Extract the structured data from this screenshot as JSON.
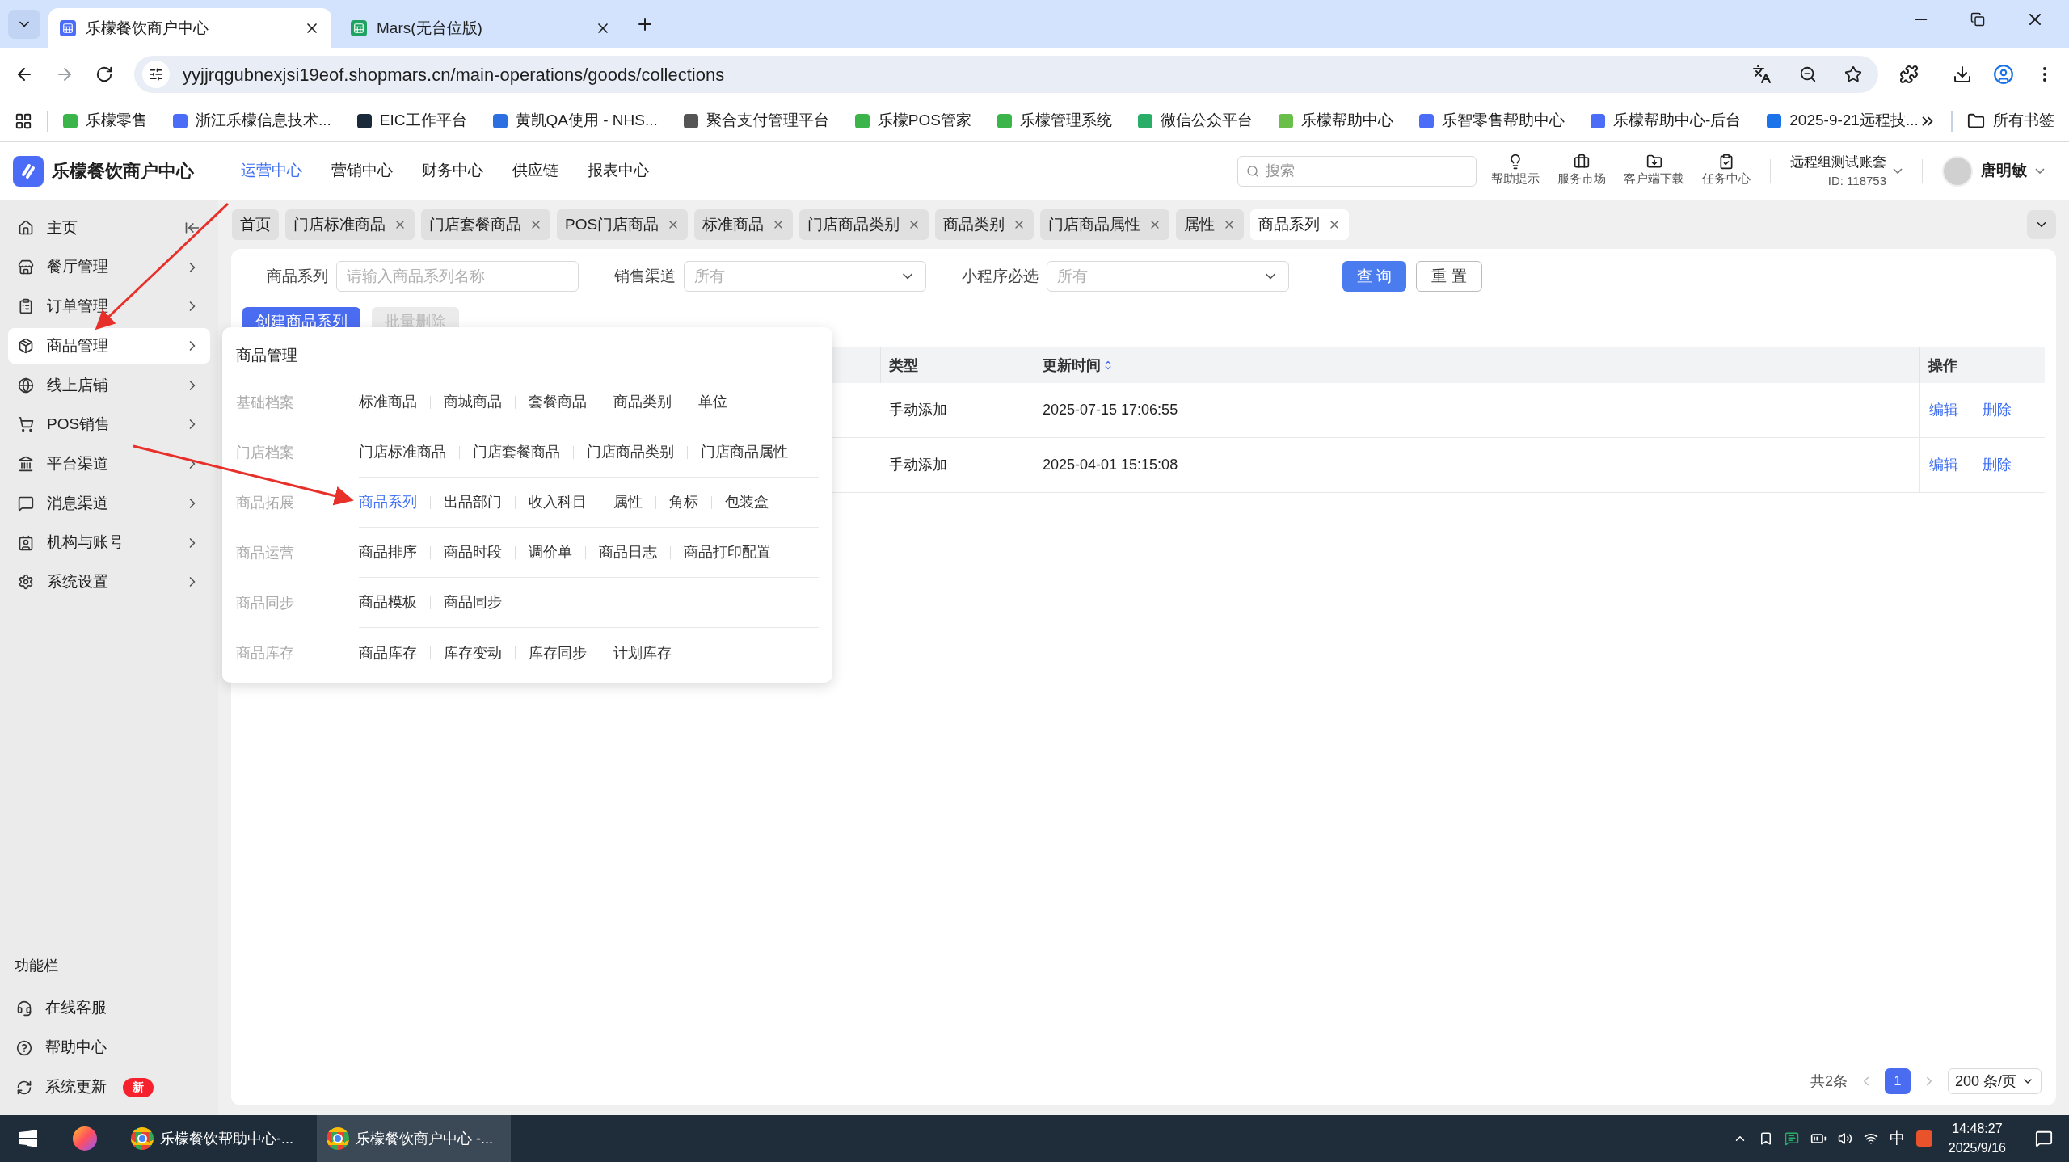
{
  "browser": {
    "tabs": [
      {
        "title": "乐檬餐饮商户中心",
        "selected": true,
        "color": "#4a6cf7"
      },
      {
        "title": "Mars(无台位版)",
        "selected": false,
        "color": "#1ea362"
      }
    ],
    "address": "yyjjrqgubnexjsi19eof.shopmars.cn/main-operations/goods/collections",
    "bookmarks": [
      {
        "label": "乐檬零售",
        "color": "#3bb54a"
      },
      {
        "label": "浙江乐檬信息技术...",
        "color": "#4a6cf7"
      },
      {
        "label": "EIC工作平台",
        "color": "#1a2a3a"
      },
      {
        "label": "黄凯QA使用 - NHS...",
        "color": "#2b6fe0"
      },
      {
        "label": "聚合支付管理平台",
        "color": "#555555"
      },
      {
        "label": "乐檬POS管家",
        "color": "#3bb54a"
      },
      {
        "label": "乐檬管理系统",
        "color": "#3bb54a"
      },
      {
        "label": "微信公众平台",
        "color": "#2aae67"
      },
      {
        "label": "乐檬帮助中心",
        "color": "#6abf4b"
      },
      {
        "label": "乐智零售帮助中心",
        "color": "#4a6cf7"
      },
      {
        "label": "乐檬帮助中心-后台",
        "color": "#4a6cf7"
      },
      {
        "label": "2025-9-21远程技...",
        "color": "#1a73e8"
      }
    ],
    "all_bookmarks": "所有书签"
  },
  "app": {
    "brand": "乐檬餐饮商户中心",
    "nav": [
      {
        "label": "运营中心",
        "selected": true
      },
      {
        "label": "营销中心",
        "selected": false
      },
      {
        "label": "财务中心",
        "selected": false
      },
      {
        "label": "供应链",
        "selected": false
      },
      {
        "label": "报表中心",
        "selected": false
      }
    ],
    "search": {
      "placeholder": "搜索"
    },
    "tools": [
      {
        "label": "帮助提示",
        "kind": "bulb"
      },
      {
        "label": "服务市场",
        "kind": "briefcase"
      },
      {
        "label": "客户端下载",
        "kind": "folder"
      },
      {
        "label": "任务中心",
        "kind": "clipboard"
      }
    ],
    "account": {
      "name": "远程组测试账套",
      "id": "ID: 118753"
    },
    "user": "唐明敏"
  },
  "sidebar": {
    "items": [
      {
        "label": "主页",
        "kind": "home",
        "selected": false
      },
      {
        "label": "餐厅管理",
        "kind": "store",
        "selected": false
      },
      {
        "label": "订单管理",
        "kind": "order",
        "selected": false
      },
      {
        "label": "商品管理",
        "kind": "goods",
        "selected": true
      },
      {
        "label": "线上店铺",
        "kind": "globe",
        "selected": false
      },
      {
        "label": "POS销售",
        "kind": "cart",
        "selected": false
      },
      {
        "label": "平台渠道",
        "kind": "bank",
        "selected": false
      },
      {
        "label": "消息渠道",
        "kind": "message",
        "selected": false
      },
      {
        "label": "机构与账号",
        "kind": "contact",
        "selected": false
      },
      {
        "label": "系统设置",
        "kind": "settings",
        "selected": false
      }
    ],
    "function_bar": {
      "title": "功能栏",
      "items": [
        {
          "label": "在线客服",
          "kind": "service"
        },
        {
          "label": "帮助中心",
          "kind": "help"
        },
        {
          "label": "系统更新",
          "kind": "update",
          "badge": "新"
        }
      ]
    }
  },
  "page_tabs": [
    {
      "label": "首页",
      "selected": false,
      "closable": false
    },
    {
      "label": "门店标准商品",
      "selected": false,
      "closable": true
    },
    {
      "label": "门店套餐商品",
      "selected": false,
      "closable": true
    },
    {
      "label": "POS门店商品",
      "selected": false,
      "closable": true
    },
    {
      "label": "标准商品",
      "selected": false,
      "closable": true
    },
    {
      "label": "门店商品类别",
      "selected": false,
      "closable": true
    },
    {
      "label": "商品类别",
      "selected": false,
      "closable": true
    },
    {
      "label": "门店商品属性",
      "selected": false,
      "closable": true
    },
    {
      "label": "属性",
      "selected": false,
      "closable": true
    },
    {
      "label": "商品系列",
      "selected": true,
      "closable": true
    }
  ],
  "filters": [
    {
      "label": "商品系列",
      "kind": "input",
      "placeholder": "请输入商品系列名称"
    },
    {
      "label": "销售渠道",
      "kind": "select",
      "placeholder": "所有"
    },
    {
      "label": "小程序必选",
      "kind": "select",
      "placeholder": "所有"
    }
  ],
  "filter_buttons": [
    {
      "label": "查 询",
      "kind": "primary"
    },
    {
      "label": "重 置",
      "kind": "default"
    }
  ],
  "actions": [
    {
      "label": "创建商品系列",
      "disabled": false
    },
    {
      "label": "批量删除",
      "disabled": true
    }
  ],
  "table": {
    "columns": [
      {
        "label": "类型",
        "sortable": false
      },
      {
        "label": "更新时间",
        "sortable": true
      },
      {
        "label": "操作",
        "sortable": false
      }
    ],
    "rows": [
      {
        "type": "手动添加",
        "updated": "2025-07-15 17:06:55",
        "actions": [
          "编辑",
          "删除"
        ]
      },
      {
        "type": "手动添加",
        "updated": "2025-04-01 15:15:08",
        "actions": [
          "编辑",
          "删除"
        ]
      }
    ]
  },
  "pagination": {
    "total": "共2条",
    "pages": [
      {
        "label": "1",
        "selected": true
      }
    ],
    "page_size": "200 条/页"
  },
  "menu": {
    "title": "商品管理",
    "groups": [
      {
        "label": "基础档案",
        "links": [
          {
            "label": "标准商品",
            "selected": false
          },
          {
            "label": "商城商品",
            "selected": false
          },
          {
            "label": "套餐商品",
            "selected": false
          },
          {
            "label": "商品类别",
            "selected": false
          },
          {
            "label": "单位",
            "selected": false
          }
        ]
      },
      {
        "label": "门店档案",
        "links": [
          {
            "label": "门店标准商品",
            "selected": false
          },
          {
            "label": "门店套餐商品",
            "selected": false
          },
          {
            "label": "门店商品类别",
            "selected": false
          },
          {
            "label": "门店商品属性",
            "selected": false
          }
        ]
      },
      {
        "label": "商品拓展",
        "links": [
          {
            "label": "商品系列",
            "selected": true
          },
          {
            "label": "出品部门",
            "selected": false
          },
          {
            "label": "收入科目",
            "selected": false
          },
          {
            "label": "属性",
            "selected": false
          },
          {
            "label": "角标",
            "selected": false
          },
          {
            "label": "包装盒",
            "selected": false
          }
        ]
      },
      {
        "label": "商品运营",
        "links": [
          {
            "label": "商品排序",
            "selected": false
          },
          {
            "label": "商品时段",
            "selected": false
          },
          {
            "label": "调价单",
            "selected": false
          },
          {
            "label": "商品日志",
            "selected": false
          },
          {
            "label": "商品打印配置",
            "selected": false
          }
        ]
      },
      {
        "label": "商品同步",
        "links": [
          {
            "label": "商品模板",
            "selected": false
          },
          {
            "label": "商品同步",
            "selected": false
          }
        ]
      },
      {
        "label": "商品库存",
        "links": [
          {
            "label": "商品库存",
            "selected": false
          },
          {
            "label": "库存变动",
            "selected": false
          },
          {
            "label": "库存同步",
            "selected": false
          },
          {
            "label": "计划库存",
            "selected": false
          }
        ]
      }
    ]
  },
  "taskbar": {
    "windows": [
      {
        "label": "乐檬餐饮帮助中心-...",
        "selected": false
      },
      {
        "label": "乐檬餐饮商户中心 -...",
        "selected": true
      }
    ],
    "ime": "中",
    "time": "14:48:27",
    "date": "2025/9/16"
  }
}
